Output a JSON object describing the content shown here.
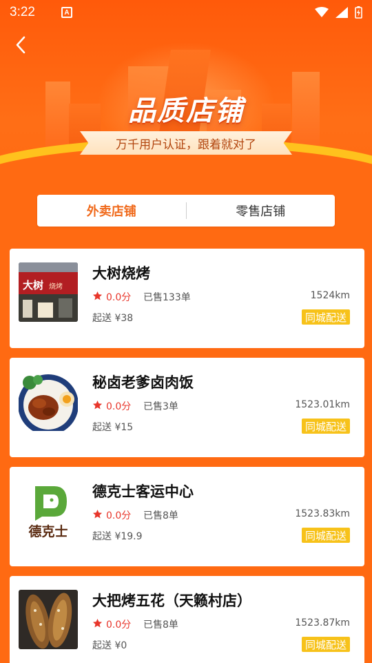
{
  "status_bar": {
    "time": "3:22",
    "notification_icon_letter": "A",
    "icons": [
      "wifi-icon",
      "signal-icon",
      "battery-charging-icon"
    ]
  },
  "header": {
    "back_icon": "chevron-left-icon",
    "title": "品质店铺",
    "subtitle": "万千用户认证，跟着就对了"
  },
  "tabs": [
    {
      "label": "外卖店铺",
      "active": true
    },
    {
      "label": "零售店铺",
      "active": false
    }
  ],
  "stores": [
    {
      "name": "大树烧烤",
      "rating": "0.0分",
      "sold": "已售133单",
      "distance": "1524km",
      "min_order": "起送 ¥38",
      "delivery": "同城配送",
      "thumb": "storefront-photo"
    },
    {
      "name": "秘卤老爹卤肉饭",
      "rating": "0.0分",
      "sold": "已售3单",
      "distance": "1523.01km",
      "min_order": "起送 ¥15",
      "delivery": "同城配送",
      "thumb": "braised-pork-rice-photo"
    },
    {
      "name": "德克士客运中心",
      "rating": "0.0分",
      "sold": "已售8单",
      "distance": "1523.83km",
      "min_order": "起送 ¥19.9",
      "delivery": "同城配送",
      "thumb": "dicos-logo",
      "logo_text": "德克士"
    },
    {
      "name": "大把烤五花（天籁村店）",
      "rating": "0.0分",
      "sold": "已售8单",
      "distance": "1523.87km",
      "min_order": "起送 ¥0",
      "delivery": "同城配送",
      "thumb": "grilled-fish-photo"
    }
  ],
  "colors": {
    "background": "#ff6a12",
    "accent": "#f06a1c",
    "rating_red": "#e8362b",
    "badge_yellow": "#f7c21a"
  }
}
